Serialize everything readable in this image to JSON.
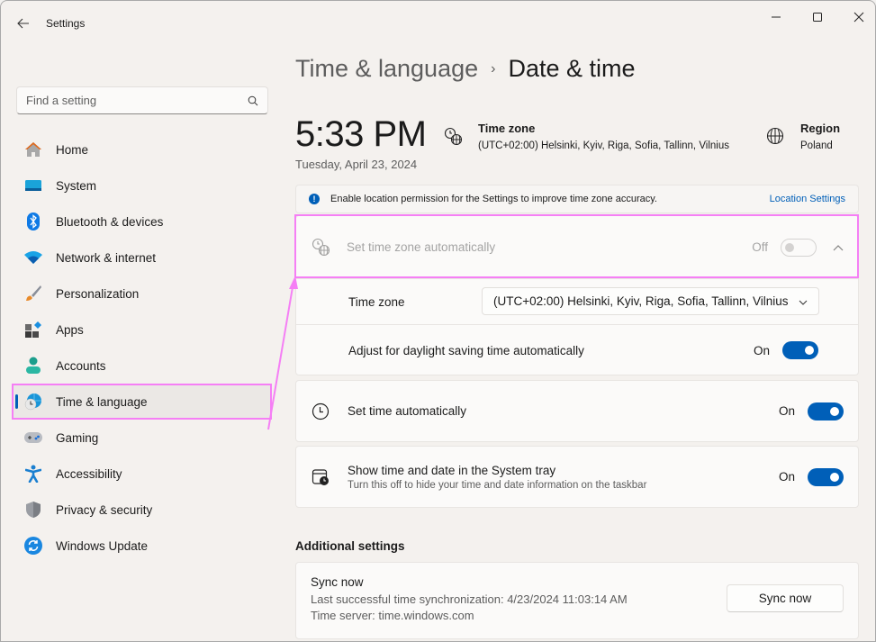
{
  "window": {
    "title": "Settings",
    "controls": {
      "minimize": "minimize",
      "maximize": "maximize",
      "close": "close"
    }
  },
  "search": {
    "placeholder": "Find a setting",
    "value": ""
  },
  "sidebar": {
    "items": [
      {
        "label": "Home",
        "icon": "home-icon",
        "active": false
      },
      {
        "label": "System",
        "icon": "system-icon",
        "active": false
      },
      {
        "label": "Bluetooth & devices",
        "icon": "bluetooth-icon",
        "active": false
      },
      {
        "label": "Network & internet",
        "icon": "wifi-icon",
        "active": false
      },
      {
        "label": "Personalization",
        "icon": "brush-icon",
        "active": false
      },
      {
        "label": "Apps",
        "icon": "apps-icon",
        "active": false
      },
      {
        "label": "Accounts",
        "icon": "person-icon",
        "active": false
      },
      {
        "label": "Time & language",
        "icon": "time-language-icon",
        "active": true
      },
      {
        "label": "Gaming",
        "icon": "gamepad-icon",
        "active": false
      },
      {
        "label": "Accessibility",
        "icon": "accessibility-icon",
        "active": false
      },
      {
        "label": "Privacy & security",
        "icon": "shield-icon",
        "active": false
      },
      {
        "label": "Windows Update",
        "icon": "update-icon",
        "active": false
      }
    ]
  },
  "breadcrumb": {
    "parent": "Time & language",
    "separator": "›",
    "current": "Date & time"
  },
  "summary": {
    "time": "5:33 PM",
    "date": "Tuesday, April 23, 2024",
    "timezone_title": "Time zone",
    "timezone_value": "(UTC+02:00) Helsinki, Kyiv, Riga, Sofia, Tallinn, Vilnius",
    "region_title": "Region",
    "region_value": "Poland"
  },
  "infobar": {
    "message": "Enable location permission for the Settings to improve time zone accuracy.",
    "link": "Location Settings"
  },
  "settings": {
    "auto_timezone": {
      "label": "Set time zone automatically",
      "state": "Off",
      "enabled": false
    },
    "timezone_select": {
      "label": "Time zone",
      "value": "(UTC+02:00) Helsinki, Kyiv, Riga, Sofia, Tallinn, Vilnius"
    },
    "daylight": {
      "label": "Adjust for daylight saving time automatically",
      "state": "On"
    },
    "auto_time": {
      "label": "Set time automatically",
      "state": "On"
    },
    "tray": {
      "label": "Show time and date in the System tray",
      "sublabel": "Turn this off to hide your time and date information on the taskbar",
      "state": "On"
    }
  },
  "additional": {
    "title": "Additional settings",
    "sync": {
      "label": "Sync now",
      "last_sync": "Last successful time synchronization: 4/23/2024 11:03:14 AM",
      "server": "Time server: time.windows.com",
      "button": "Sync now"
    }
  },
  "colors": {
    "accent": "#005fb8",
    "annotation": "#f57ff5"
  }
}
